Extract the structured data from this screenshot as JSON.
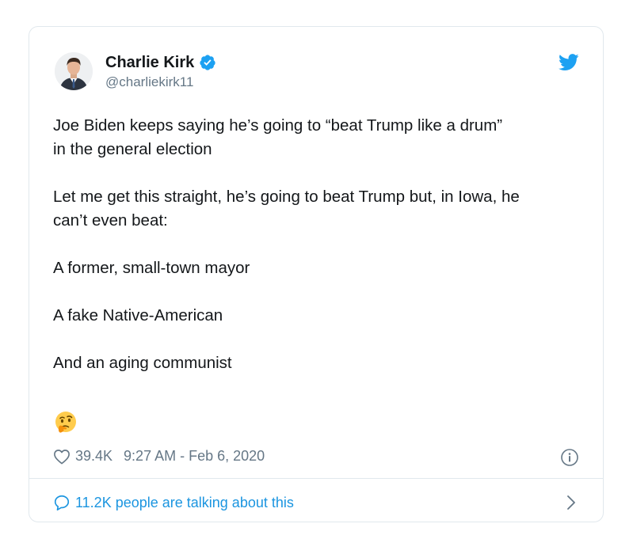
{
  "author": {
    "display_name": "Charlie Kirk",
    "handle": "@charliekirk11",
    "verified": true
  },
  "tweet": {
    "paragraphs": [
      "Joe Biden keeps saying he’s going to “beat Trump like a drum”\nin the general election",
      "Let me get this straight, he’s going to beat Trump but, in Iowa, he\ncan’t even beat:",
      "A former, small-town mayor",
      "A fake Native-American",
      "And an aging communist"
    ],
    "emoji": "thinking-face"
  },
  "meta": {
    "likes": "39.4K",
    "timestamp": "9:27 AM - Feb 6, 2020"
  },
  "conversation": {
    "label": "11.2K people are talking about this"
  },
  "colors": {
    "twitter_blue": "#1da1f2",
    "link_blue": "#1b95e0",
    "text": "#14171a",
    "secondary": "#657786",
    "border": "#e1e8ed"
  }
}
